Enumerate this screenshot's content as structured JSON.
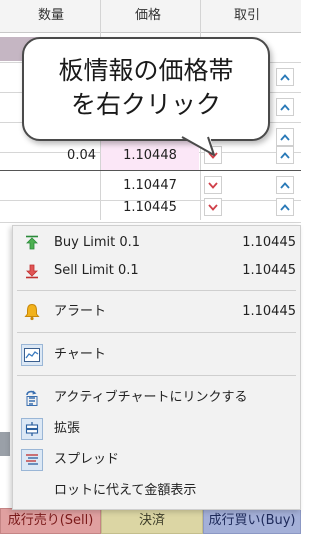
{
  "table": {
    "headers": {
      "volume": "数量",
      "price": "価格",
      "trade": "取引"
    },
    "rows": [
      {
        "volume": "",
        "price": ""
      },
      {
        "volume": "",
        "price": ""
      },
      {
        "volume": "",
        "price": ""
      },
      {
        "volume": "",
        "price": ""
      },
      {
        "volume": "0.04",
        "price": "1.10448",
        "highlight": true
      },
      {
        "volume": "",
        "price": "1.10447"
      },
      {
        "volume": "",
        "price": "1.10445"
      }
    ]
  },
  "callout": {
    "line1": "板情報の価格帯",
    "line2": "を右クリック"
  },
  "menu": {
    "buy_limit": {
      "label": "Buy Limit 0.1",
      "value": "1.10445"
    },
    "sell_limit": {
      "label": "Sell Limit 0.1",
      "value": "1.10445"
    },
    "alert": {
      "label": "アラート",
      "value": "1.10445"
    },
    "chart": {
      "label": "チャート"
    },
    "link_chart": {
      "label": "アクティブチャートにリンクする"
    },
    "expand": {
      "label": "拡張"
    },
    "spread": {
      "label": "スプレッド"
    },
    "amount_display": {
      "label": "ロットに代えて金額表示"
    }
  },
  "buttons": {
    "sell": "成行売り(Sell)",
    "close": "決済",
    "buy": "成行買い(Buy)"
  },
  "colors": {
    "highlight_price": "#fbe7f7",
    "chevron_down": "#d0404a",
    "chevron_up": "#2a7ab8",
    "sell_button": "#e0a0a0",
    "close_button": "#dcd6a4",
    "buy_button": "#a4b0d8"
  }
}
